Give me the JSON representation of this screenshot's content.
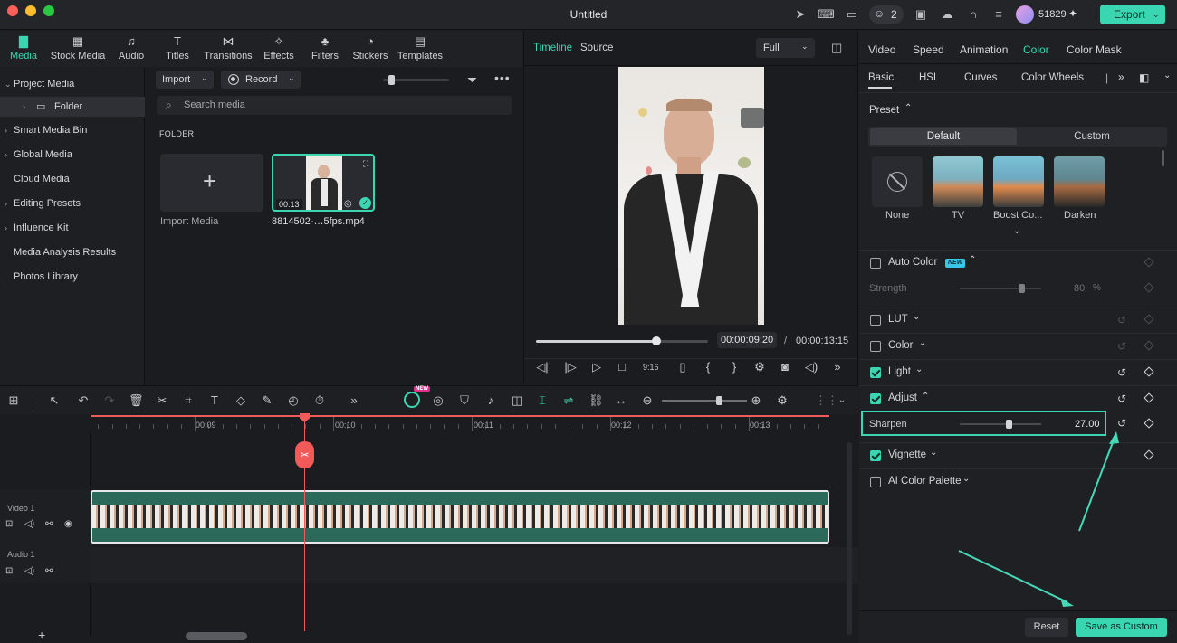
{
  "window": {
    "title": "Untitled"
  },
  "titlebar": {
    "collab_count": "2",
    "credits": "51829",
    "export_label": "Export"
  },
  "media_tabs": [
    {
      "label": "Media",
      "icon": "media-icon"
    },
    {
      "label": "Stock Media",
      "icon": "stock-media-icon"
    },
    {
      "label": "Audio",
      "icon": "music-note-icon"
    },
    {
      "label": "Titles",
      "icon": "titles-icon"
    },
    {
      "label": "Transitions",
      "icon": "transitions-icon"
    },
    {
      "label": "Effects",
      "icon": "effects-icon"
    },
    {
      "label": "Filters",
      "icon": "filters-icon"
    },
    {
      "label": "Stickers",
      "icon": "stickers-icon"
    },
    {
      "label": "Templates",
      "icon": "templates-icon"
    }
  ],
  "sidebar": {
    "items": [
      {
        "label": "Project Media"
      },
      {
        "label": "Folder"
      },
      {
        "label": "Smart Media Bin"
      },
      {
        "label": "Global Media"
      },
      {
        "label": "Cloud Media"
      },
      {
        "label": "Editing Presets"
      },
      {
        "label": "Influence Kit"
      },
      {
        "label": "Media Analysis Results"
      },
      {
        "label": "Photos Library"
      }
    ]
  },
  "browser": {
    "import_label": "Import",
    "record_label": "Record",
    "search_placeholder": "Search media",
    "folder_heading": "FOLDER",
    "import_media_label": "Import Media",
    "clip_name": "8814502-…5fps.mp4",
    "clip_duration": "00:13"
  },
  "preview": {
    "tab_timeline": "Timeline",
    "tab_source": "Source",
    "zoom": "Full",
    "current_time": "00:00:09:20",
    "separator": "/",
    "total_time": "00:00:13:15",
    "playhead_progress": 0.7
  },
  "right_panel": {
    "tabs": [
      "Video",
      "Speed",
      "Animation",
      "Color",
      "Color Mask"
    ],
    "active_tab": "Color",
    "subtabs": [
      "Basic",
      "HSL",
      "Curves",
      "Color Wheels"
    ],
    "preset_label": "Preset",
    "preset_default": "Default",
    "preset_custom": "Custom",
    "presets": [
      {
        "label": "None"
      },
      {
        "label": "TV"
      },
      {
        "label": "Boost Co..."
      },
      {
        "label": "Darken"
      }
    ],
    "auto_color_label": "Auto Color",
    "new_badge": "NEW",
    "strength_label": "Strength",
    "strength_value": "80",
    "strength_unit": "%",
    "strength_level": 0.75,
    "lut_label": "LUT",
    "color_label": "Color",
    "light_label": "Light",
    "adjust_label": "Adjust",
    "sharpen_label": "Sharpen",
    "sharpen_value": "27.00",
    "sharpen_level": 0.6,
    "vignette_label": "Vignette",
    "ai_palette_label": "AI Color Palette",
    "reset_label": "Reset",
    "save_custom_label": "Save as Custom"
  },
  "timeline": {
    "ticks": [
      "00:09",
      "00:10",
      "00:11",
      "00:12",
      "00:13"
    ],
    "video_track_label": "Video 1",
    "audio_track_label": "Audio 1",
    "ai_badge": "NEW"
  },
  "colors": {
    "accent": "#3ad6b2",
    "playhead": "#f25a5a",
    "clip": "#2b6a5a"
  }
}
